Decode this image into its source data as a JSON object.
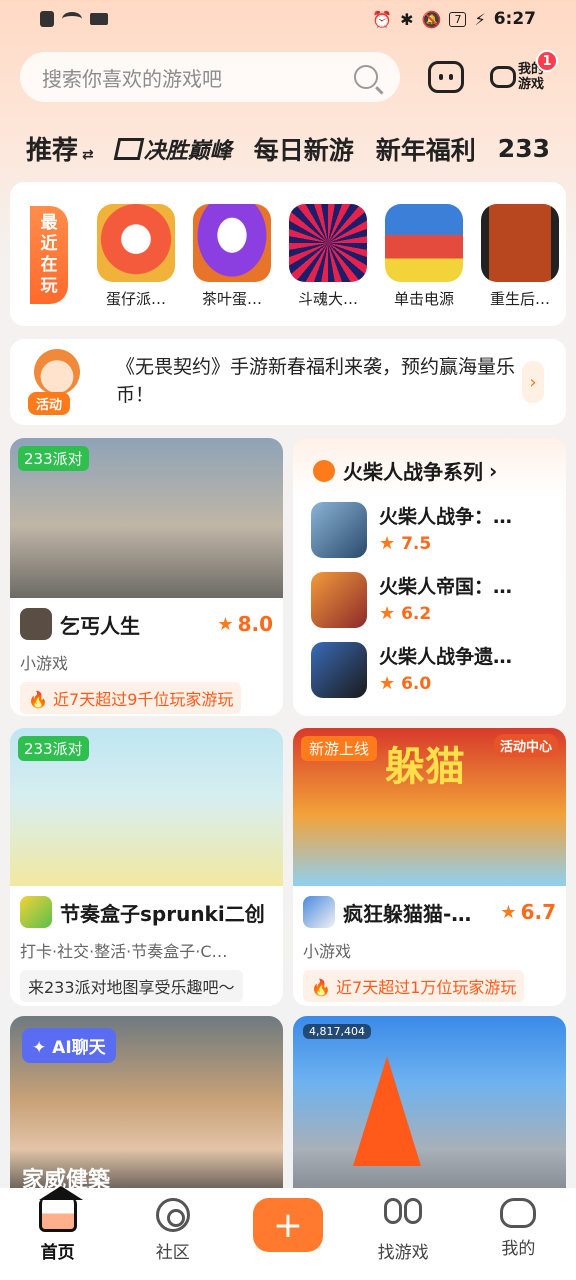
{
  "status_bar": {
    "time": "6:27",
    "battery": "7"
  },
  "header": {
    "search_placeholder": "搜索你喜欢的游戏吧",
    "my_games_label": "我的游戏",
    "my_games_badge": "1"
  },
  "tabs": [
    {
      "label": "推荐",
      "active": true
    },
    {
      "label": "决胜巅峰",
      "active": false
    },
    {
      "label": "每日新游",
      "active": false
    },
    {
      "label": "新年福利",
      "active": false
    },
    {
      "label": "233",
      "active": false
    }
  ],
  "recent": {
    "label": "最近在玩",
    "items": [
      {
        "name": "蛋仔派…",
        "color": "#f45b3c"
      },
      {
        "name": "茶叶蛋…",
        "color": "#8c3fe0"
      },
      {
        "name": "斗魂大…",
        "color": "#1b1f6b"
      },
      {
        "name": "单击电源",
        "color": "#3c7fd9"
      },
      {
        "name": "重生后…",
        "color": "#b8461f"
      }
    ]
  },
  "activity": {
    "tag": "活动",
    "text": "《无畏契约》手游新春福利来袭，预约赢海量乐币！"
  },
  "cards": {
    "c1": {
      "tag": "233派对",
      "title": "乞丐人生",
      "rating": "8.0",
      "subtitle": "小游戏",
      "hot": "近7天超过9千位玩家游玩"
    },
    "c2": {
      "tag": "233派对",
      "title": "节奏盒子sprunki二创",
      "subtitle": "打卡·社交·整活·节奏盒子·C…",
      "quote": "来233派对地图享受乐趣吧～"
    },
    "c3": {
      "tag": "新游上线",
      "title": "疯狂躲猫猫-…",
      "rating": "6.7",
      "subtitle": "小游戏",
      "hot": "近7天超过1万位玩家游玩",
      "banner_text": "躲猫",
      "event_label": "活动中心"
    },
    "c4": {
      "tag": "AI聊天",
      "overlay_text": "家威健築"
    },
    "c5": {
      "score_text": "4,817,404"
    }
  },
  "series": {
    "title": "火柴人战争系列",
    "items": [
      {
        "name": "火柴人战争：…",
        "rating": "7.5"
      },
      {
        "name": "火柴人帝国：…",
        "rating": "6.2"
      },
      {
        "name": "火柴人战争遗…",
        "rating": "6.0"
      }
    ]
  },
  "bottom_nav": {
    "home": "首页",
    "community": "社区",
    "find": "找游戏",
    "mine": "我的"
  },
  "colors": {
    "accent": "#ff7a1a",
    "green_tag": "#2fbf4f",
    "ai_tag": "#5a6cf2"
  }
}
